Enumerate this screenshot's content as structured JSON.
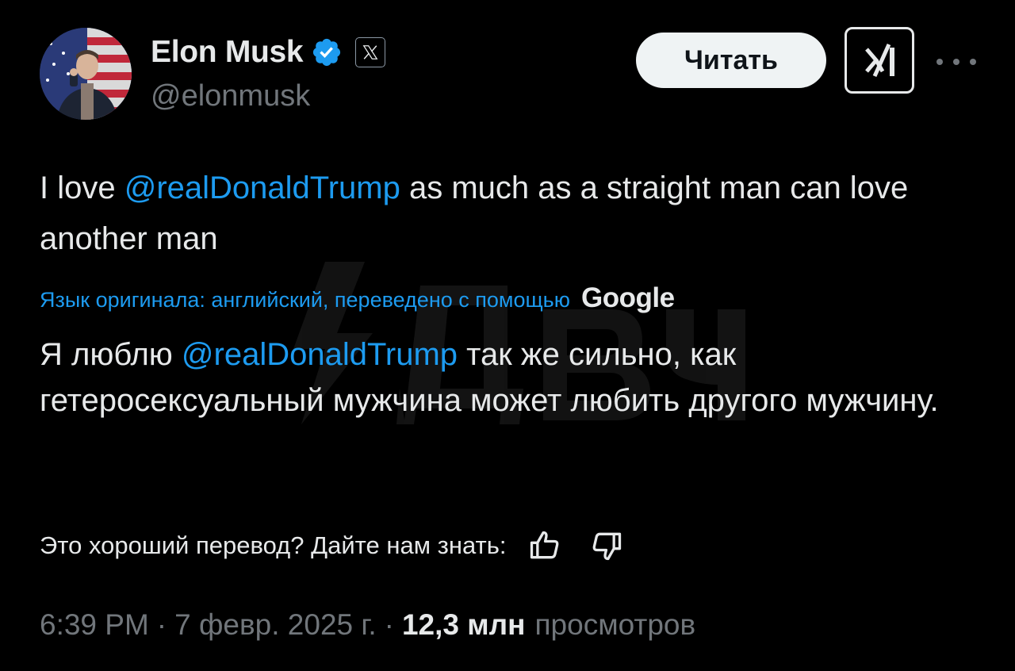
{
  "author": {
    "display_name": "Elon Musk",
    "handle": "@elonmusk",
    "verified_icon": "verified-badge-icon",
    "affiliation_icon": "x-logo-icon"
  },
  "actions": {
    "read_label": "Читать",
    "grok_icon": "grok-icon",
    "more_icon": "more-icon"
  },
  "tweet": {
    "text_before": "I love ",
    "mention": "@realDonaldTrump",
    "text_after": " as much as a straight man can love another man"
  },
  "translation": {
    "note": "Язык оригинала: английский, переведено с помощью",
    "provider": "Google",
    "text_before": "Я люблю ",
    "mention": "@realDonaldTrump",
    "text_after": " так же сильно, как гетеросексуальный мужчина может любить другого мужчину."
  },
  "feedback": {
    "prompt": "Это хороший перевод? Дайте нам знать:",
    "like_icon": "thumbs-up-icon",
    "dislike_icon": "thumbs-down-icon"
  },
  "meta": {
    "time": "6:39 PM",
    "separator": "·",
    "date": "7 февр. 2025 г.",
    "views_count": "12,3 млн",
    "views_label": "просмотров"
  },
  "colors": {
    "background": "#000000",
    "text": "#e7e9ea",
    "muted": "#71767b",
    "accent": "#1d9bf0",
    "verified": "#1d9bf0"
  }
}
